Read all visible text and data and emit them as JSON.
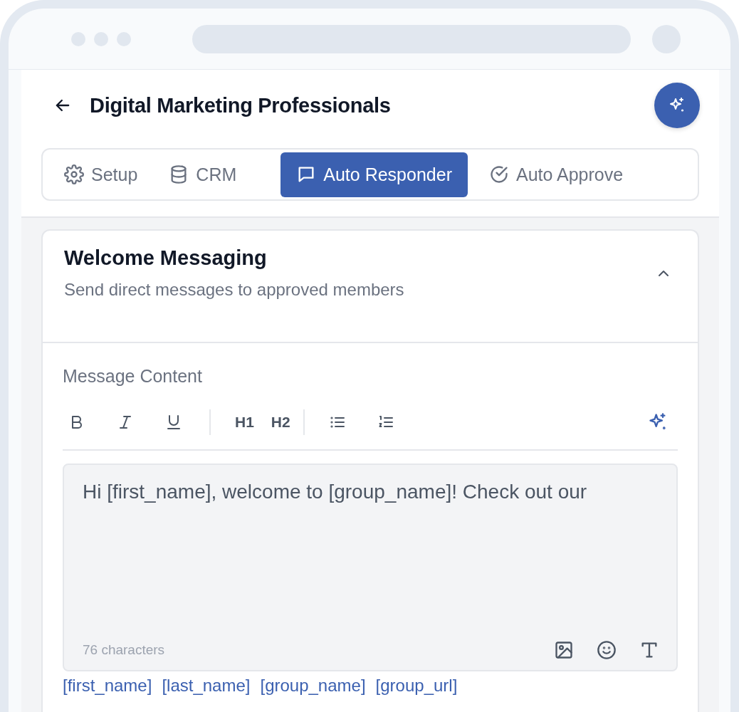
{
  "header": {
    "title": "Digital Marketing Professionals"
  },
  "tabs": [
    {
      "label": "Setup",
      "selected": false
    },
    {
      "label": "CRM",
      "selected": false
    },
    {
      "label": "Auto Responder",
      "selected": true
    },
    {
      "label": "Auto Approve",
      "selected": false
    }
  ],
  "card": {
    "title": "Welcome Messaging",
    "subtitle": "Send direct messages to approved members",
    "expanded": true,
    "field_label": "Message Content",
    "toolbar": [
      {
        "kind": "bold"
      },
      {
        "kind": "italic"
      },
      {
        "kind": "underline"
      },
      {
        "kind": "separator"
      },
      {
        "kind": "heading",
        "label": "H1"
      },
      {
        "kind": "heading",
        "label": "H2"
      },
      {
        "kind": "separator"
      },
      {
        "kind": "bullets"
      },
      {
        "kind": "numbers"
      }
    ],
    "editor": {
      "value": "Hi [first_name], welcome to [group_name]! Check out our",
      "count": "76 characters"
    },
    "variables": [
      "[first_name]",
      "[last_name]",
      "[group_name]",
      "[group_url]"
    ]
  }
}
